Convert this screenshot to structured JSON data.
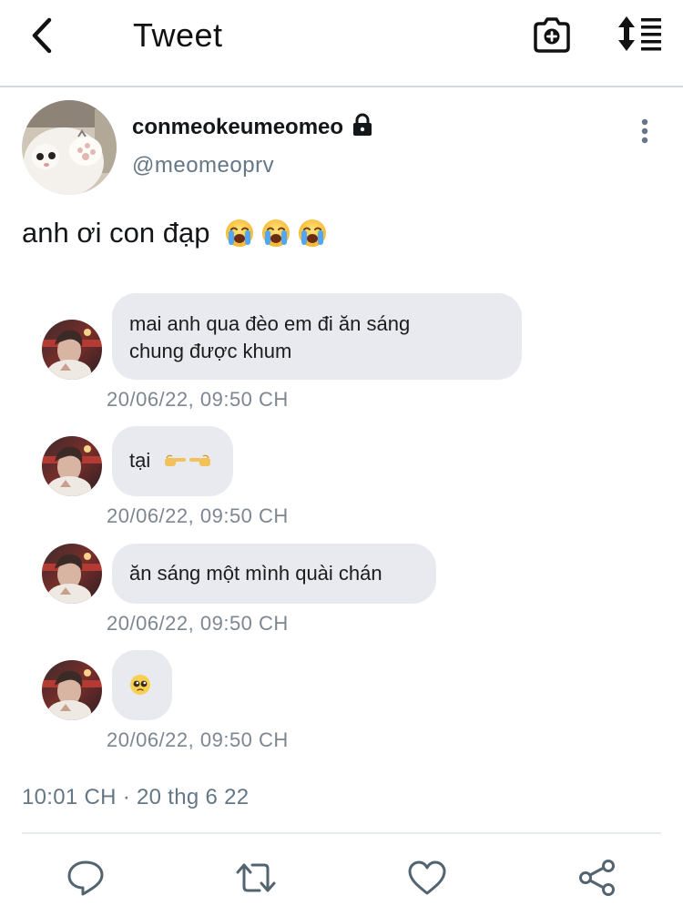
{
  "header": {
    "title": "Tweet",
    "icons": [
      "back-arrow-icon",
      "camera-plus-icon",
      "sort-icon"
    ]
  },
  "author": {
    "display_name": "conmeokeumeomeo",
    "handle": "@meomeoprv",
    "protected_icon": "lock-icon"
  },
  "tweet": {
    "text": "anh ơi con đạp",
    "emojis": [
      "crying-face",
      "crying-face",
      "crying-face"
    ]
  },
  "messages": [
    {
      "line1": "mai anh qua đèo em đi ăn sáng",
      "line2": "chung được khum",
      "time": "20/06/22, 09:50 CH"
    },
    {
      "text": "tại",
      "time": "20/06/22, 09:50 CH"
    },
    {
      "text": "ăn sáng một mình quài chán",
      "time": "20/06/22, 09:50 CH"
    },
    {
      "text": "",
      "time": "20/06/22, 09:50 CH"
    }
  ],
  "footer": {
    "timestamp": "10:01 CH · 20 thg 6 22",
    "actions": [
      "reply-icon",
      "retweet-icon",
      "like-icon",
      "share-icon"
    ]
  },
  "colors": {
    "bubble": "#e9eaef",
    "secondary_text": "#657786",
    "action_icon": "#536471"
  }
}
